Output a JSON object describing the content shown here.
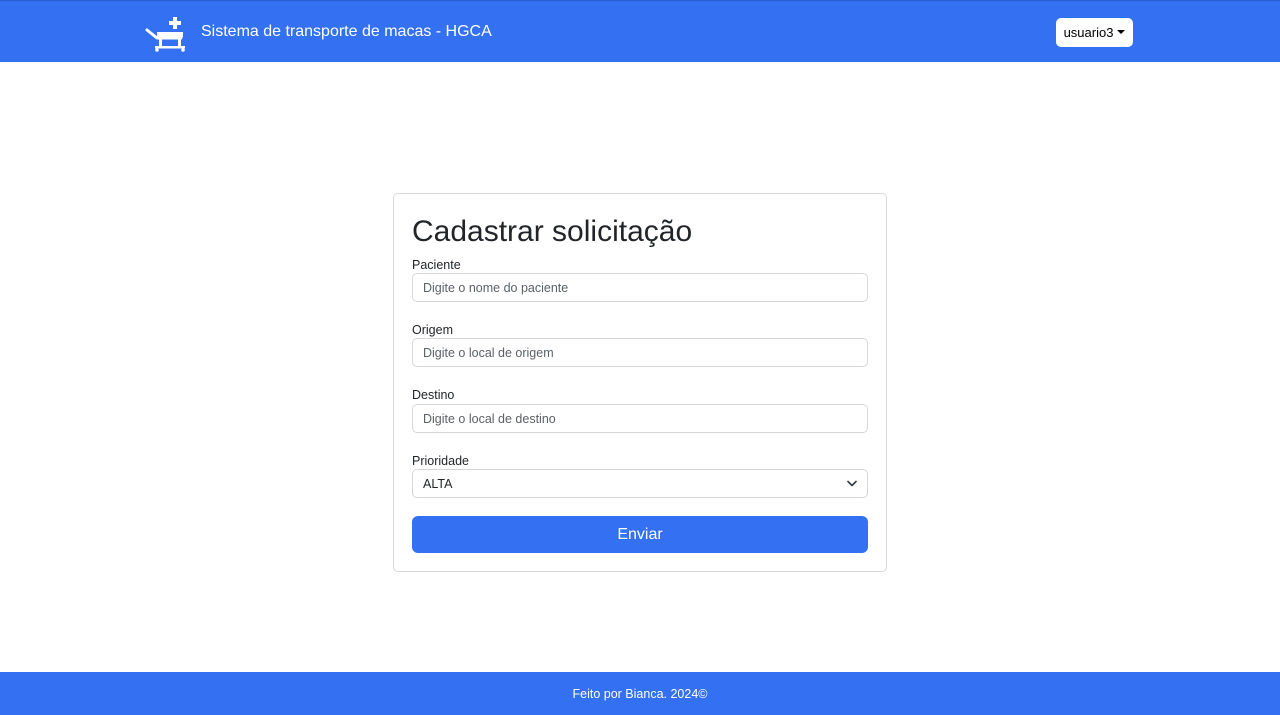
{
  "header": {
    "title": "Sistema de transporte de macas - HGCA",
    "logo_icon": "stretcher-cross-icon",
    "user_menu_label": "usuario3",
    "background_color": "#3370f2"
  },
  "form": {
    "title": "Cadastrar solicitação",
    "fields": [
      {
        "label": "Paciente",
        "placeholder": "Digite o nome do paciente",
        "value": ""
      },
      {
        "label": "Origem",
        "placeholder": "Digite o local de origem",
        "value": ""
      },
      {
        "label": "Destino",
        "placeholder": "Digite o local de destino",
        "value": ""
      }
    ],
    "priority": {
      "label": "Prioridade",
      "selected": "ALTA"
    },
    "submit_label": "Enviar"
  },
  "footer": {
    "text": "Feito por Bianca. 2024©"
  }
}
